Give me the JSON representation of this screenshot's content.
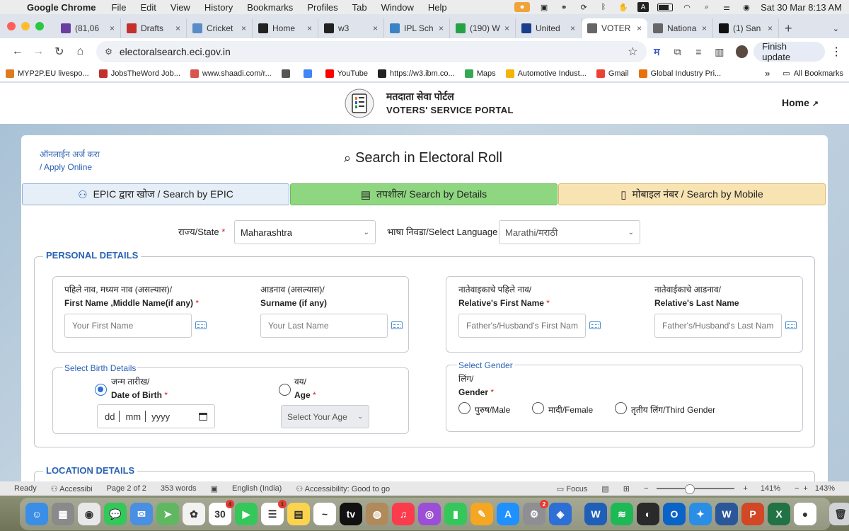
{
  "menubar": {
    "app_name": "Google Chrome",
    "menus": [
      "File",
      "Edit",
      "View",
      "History",
      "Bookmarks",
      "Profiles",
      "Tab",
      "Window",
      "Help"
    ],
    "datetime": "Sat 30 Mar  8:13 AM"
  },
  "tabs": [
    {
      "title": "(81,06",
      "color": "#6b3fa0"
    },
    {
      "title": "Drafts",
      "color": "#c4302b"
    },
    {
      "title": "Cricket",
      "color": "#5a8dc8"
    },
    {
      "title": "Home",
      "color": "#222222"
    },
    {
      "title": "w3",
      "color": "#222222"
    },
    {
      "title": "IPL Sch",
      "color": "#3b82c4"
    },
    {
      "title": "(190) W",
      "color": "#25a244"
    },
    {
      "title": "United",
      "color": "#1a3e8c"
    },
    {
      "title": "VOTER",
      "color": "#666666",
      "active": true
    },
    {
      "title": "Nationa",
      "color": "#666666"
    },
    {
      "title": "(1) San",
      "color": "#111111"
    }
  ],
  "address": {
    "url": "electoralsearch.eci.gov.in",
    "finish_update": "Finish update",
    "translate_glyph": "म"
  },
  "bookmarks": [
    {
      "label": "MYP2P.EU livespo...",
      "color": "#e07a1f"
    },
    {
      "label": "JobsTheWord Job...",
      "color": "#c4302b"
    },
    {
      "label": "www.shaadi.com/r...",
      "color": "#d9534f"
    },
    {
      "label": "",
      "color": "#555555"
    },
    {
      "label": "",
      "color": "#4285f4"
    },
    {
      "label": "YouTube",
      "color": "#ff0000"
    },
    {
      "label": "https://w3.ibm.co...",
      "color": "#222222"
    },
    {
      "label": "Maps",
      "color": "#34a853"
    },
    {
      "label": "Automotive Indust...",
      "color": "#f4b400"
    },
    {
      "label": "Gmail",
      "color": "#ea4335"
    },
    {
      "label": "Global Industry Pri...",
      "color": "#e8710a"
    }
  ],
  "bookmarks_more": "»",
  "all_bookmarks": "All Bookmarks",
  "site": {
    "title_hi": "मतदाता सेवा पोर्टल",
    "title_en": "VOTERS' SERVICE PORTAL",
    "home": "Home"
  },
  "apply_online": {
    "line1": "ऑनलाईन अर्ज करा",
    "line2": "/ Apply Online"
  },
  "search_title": "Search in Electoral Roll",
  "modes": {
    "epic": "EPIC द्वारा खोज / Search by EPIC",
    "details": "तपशील/ Search by Details",
    "mobile": "मोबाइल नंबर / Search by Mobile"
  },
  "state": {
    "label": "राज्य/State",
    "value": "Maharashtra"
  },
  "language": {
    "label": "भाषा निवडा/Select Language",
    "value": "Marathi/मराठी"
  },
  "required_mark": "*",
  "personal": {
    "legend": "PERSONAL DETAILS",
    "first_name": {
      "label_hi": "पहिले नाव, मध्यम नाव (असल्यास)/",
      "label_en": "First Name ,Middle Name(if any)",
      "placeholder": "Your First Name"
    },
    "surname": {
      "label_hi": "आडनाव (असल्यास)/",
      "label_en": "Surname (if any)",
      "placeholder": "Your Last Name"
    },
    "rel_first": {
      "label_hi": "नातेवाइकाचे पहिले नाव/",
      "label_en": "Relative's First Name",
      "placeholder": "Father's/Husband's First Name"
    },
    "rel_last": {
      "label_hi": "नातेवाईकाचे आडनाव/",
      "label_en": "Relative's Last Name",
      "placeholder": "Father's/Husband's Last Name"
    },
    "birth": {
      "legend": "Select Birth Details",
      "dob_hi": "जन्म तारीख/",
      "dob_en": "Date of Birth",
      "date_dd": "dd",
      "date_mm": "mm",
      "date_yyyy": "yyyy",
      "age_hi": "वय/",
      "age_en": "Age",
      "age_placeholder": "Select Your Age"
    },
    "gender": {
      "legend": "Select Gender",
      "label_hi": "लिंग/",
      "label_en": "Gender",
      "male": "पुरुष/Male",
      "female": "मादी/Female",
      "third": "तृतीय लिंग/Third Gender"
    }
  },
  "location": {
    "legend": "LOCATION DETAILS"
  },
  "word_status": {
    "ready": "Ready",
    "accessibility": "Accessibi",
    "page": "Page 2 of 2",
    "words": "353 words",
    "lang": "English (India)",
    "acc_good": "Accessibility: Good to go",
    "focus": "Focus",
    "zoom_left": "141%",
    "zoom_right": "143%"
  },
  "dock": [
    {
      "name": "finder",
      "color": "#3a8ee6",
      "glyph": "☺"
    },
    {
      "name": "launchpad",
      "color": "#8a8a8a",
      "glyph": "▦"
    },
    {
      "name": "chrome",
      "color": "#e8e8e8",
      "glyph": "◉"
    },
    {
      "name": "messages",
      "color": "#34c759",
      "glyph": "💬"
    },
    {
      "name": "mail",
      "color": "#4a90e2",
      "glyph": "✉"
    },
    {
      "name": "maps",
      "color": "#5fb85f",
      "glyph": "➤"
    },
    {
      "name": "photos",
      "color": "#f2f2f2",
      "glyph": "✿"
    },
    {
      "name": "calendar",
      "color": "#ffffff",
      "glyph": "30",
      "badge": "4"
    },
    {
      "name": "facetime",
      "color": "#34c759",
      "glyph": "▶"
    },
    {
      "name": "reminders",
      "color": "#ffffff",
      "glyph": "☰",
      "badge": "1"
    },
    {
      "name": "notes",
      "color": "#fbd34d",
      "glyph": "▤"
    },
    {
      "name": "freeform",
      "color": "#ffffff",
      "glyph": "~"
    },
    {
      "name": "appletv",
      "color": "#111111",
      "glyph": "tv"
    },
    {
      "name": "contacts",
      "color": "#b08a5a",
      "glyph": "◍"
    },
    {
      "name": "music",
      "color": "#fa3c4c",
      "glyph": "♫"
    },
    {
      "name": "podcasts",
      "color": "#9b4fd6",
      "glyph": "◎"
    },
    {
      "name": "numbers",
      "color": "#34c759",
      "glyph": "▮"
    },
    {
      "name": "pages",
      "color": "#f5a623",
      "glyph": "✎"
    },
    {
      "name": "appstore",
      "color": "#1e90ff",
      "glyph": "A"
    },
    {
      "name": "settings",
      "color": "#8e8e93",
      "glyph": "⚙",
      "badge": "2"
    },
    {
      "name": "security",
      "color": "#2e6fd6",
      "glyph": "◈"
    },
    {
      "name": "zoom",
      "color": "#1f5fb8",
      "glyph": "W"
    },
    {
      "name": "spotify",
      "color": "#1db954",
      "glyph": "≋"
    },
    {
      "name": "safari-alt",
      "color": "#2a2a2a",
      "glyph": "◐"
    },
    {
      "name": "outlook",
      "color": "#0a64c8",
      "glyph": "O"
    },
    {
      "name": "safari",
      "color": "#2a8ee6",
      "glyph": "✦"
    },
    {
      "name": "word",
      "color": "#2b579a",
      "glyph": "W"
    },
    {
      "name": "powerpoint",
      "color": "#d24726",
      "glyph": "P"
    },
    {
      "name": "excel",
      "color": "#217346",
      "glyph": "X"
    },
    {
      "name": "recorder",
      "color": "#ffffff",
      "glyph": "●"
    },
    {
      "name": "trash",
      "color": "#cfd3d6",
      "glyph": "🗑"
    }
  ]
}
